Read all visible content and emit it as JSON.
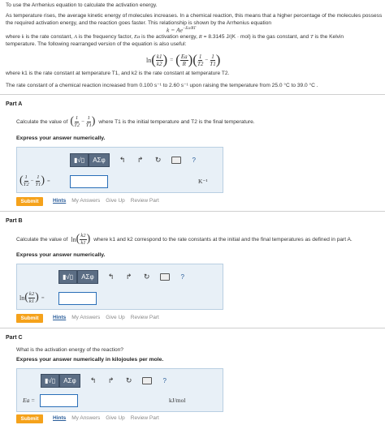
{
  "intro": {
    "line1": "To use the Arrhenius equation to calculate the activation energy.",
    "line2": "As temperature rises, the average kinetic energy of molecules increases. In a chemical reaction, this means that a higher percentage of the molecules possess",
    "line3": "the required activation energy, and the reaction goes faster. This relationship is shown by the Arrhenius equation",
    "equation_main": "k = Ae",
    "equation_exp": "−Ea/RT",
    "line4a": "where ",
    "var_k": "k",
    "line4b": " is the rate constant, ",
    "var_A": "A",
    "line4c": " is the frequency factor, ",
    "var_Ea": "Ea",
    "line4d": " is the activation energy, ",
    "var_R": "R",
    "line4e": " = 8.3145 J/(K · mol) is the gas constant, and ",
    "var_T": "T",
    "line4f": " is the Kelvin",
    "line5": "temperature. The following rearranged version of the equation is also useful:",
    "ln": "ln",
    "k1": "k1",
    "k2": "k2",
    "Ea": "Ea",
    "R": "R",
    "one": "1",
    "T2": "T2",
    "T1": "T1",
    "eq": "=",
    "minus": "−",
    "line6": "where k1 is the rate constant at temperature T1, and k2 is the rate constant at temperature T2.",
    "line7": "The rate constant of a chemical reaction increased from 0.100 s⁻¹ to 2.60 s⁻¹ upon raising the temperature from 25.0 °C to 39.0 °C ."
  },
  "part_a": {
    "title": "Part A",
    "question_prefix": "Calculate the value of",
    "question_suffix": "where T1 is the initial temperature and T2 is the final temperature.",
    "instruction": "Express your answer numerically.",
    "unit": "K⁻¹"
  },
  "part_b": {
    "title": "Part B",
    "question_prefix": "Calculate the value of",
    "question_suffix": "where k1 and k2 correspond to the rate constants at the initial and the final temperatures as defined in part A.",
    "instruction": "Express your answer numerically."
  },
  "part_c": {
    "title": "Part C",
    "question": "What is the activation energy of the reaction?",
    "instruction": "Express your answer numerically in kilojoules per mole.",
    "label": "Ea",
    "unit": "kJ/mol"
  },
  "toolbar": {
    "templates": "▮√▯",
    "greek": "ΑΣφ",
    "undo": "↰",
    "redo": "↱",
    "reset": "↻",
    "help": "?"
  },
  "actions": {
    "submit": "Submit",
    "hints": "Hints",
    "my_answers": "My Answers",
    "give_up": "Give Up",
    "review_part": "Review Part"
  }
}
